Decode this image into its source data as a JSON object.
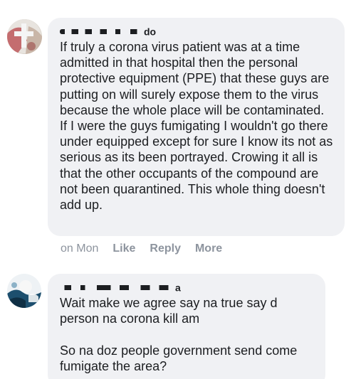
{
  "comments": [
    {
      "author_visible_fragment": "do",
      "text": "If truly a corona virus patient was at a time admitted in that hospital then the personal protective equipment (PPE) that these guys are putting on will surely expose them to the virus because the whole place will be contaminated. If I were the guys fumigating I wouldn't go there under equipped except for sure I know its not as serious as its been portrayed. Crowing it all is that the other occupants of the compound are not been quarantined. This whole thing doesn't add up.",
      "timestamp": "on Mon",
      "actions": [
        "Like",
        "Reply",
        "More"
      ]
    },
    {
      "author_visible_fragment": "a",
      "text": "Wait make we agree say na true say d person na corona kill am\n\nSo na doz people government send come fumigate the area?"
    }
  ],
  "colors": {
    "bubble": "#f0f1f4",
    "text": "#1c1e21",
    "meta": "#8d949e"
  }
}
